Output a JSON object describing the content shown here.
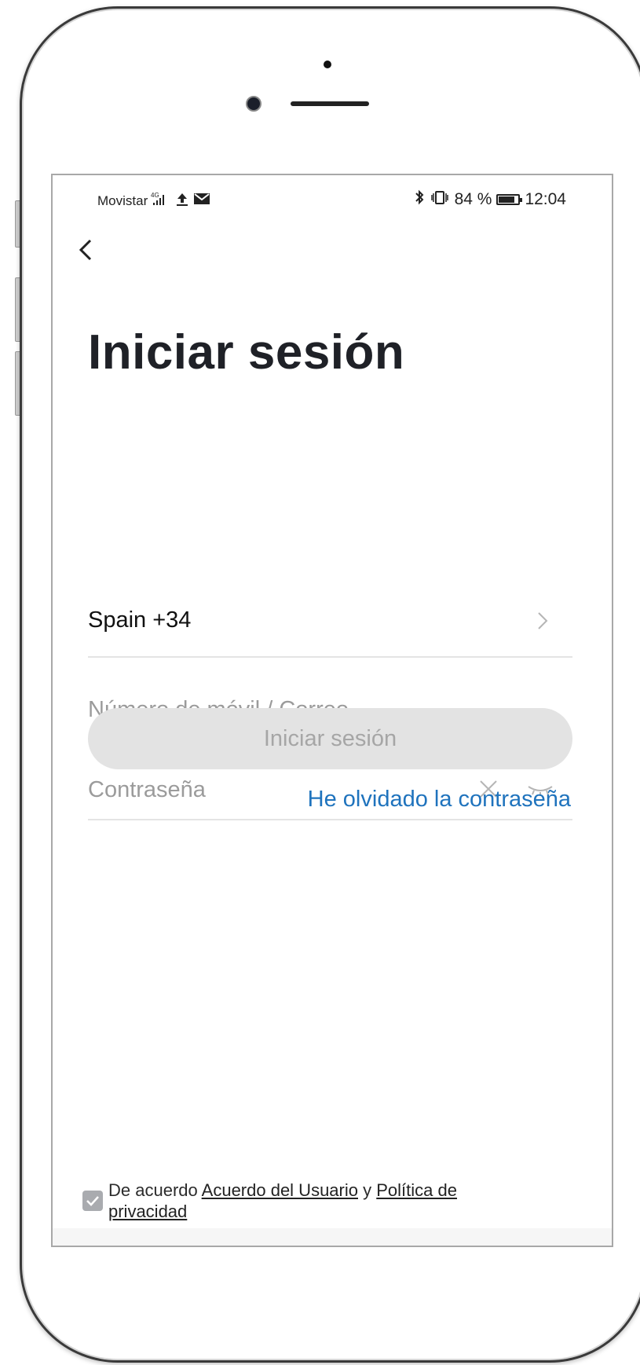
{
  "status_bar": {
    "carrier": "Movistar",
    "network": "4G",
    "battery_percent": "84 %",
    "battery_level": 0.84,
    "time": "12:04"
  },
  "page": {
    "title": "Iniciar sesión"
  },
  "form": {
    "country_value": "Spain +34",
    "phone_placeholder": "Número de móvil / Correo",
    "password_placeholder": "Contraseña",
    "login_label": "Iniciar sesión",
    "forgot_label": "He olvidado la contraseña"
  },
  "agreement": {
    "prefix": "De acuerdo",
    "user_agreement": "Acuerdo del Usuario",
    "connector": "y",
    "privacy_policy_line1": "Política de",
    "privacy_policy_line2": "privacidad",
    "checked": true
  },
  "colors": {
    "link": "#1f73bd",
    "button_disabled_bg": "#e3e3e3",
    "button_disabled_text": "#a6a6a6"
  }
}
